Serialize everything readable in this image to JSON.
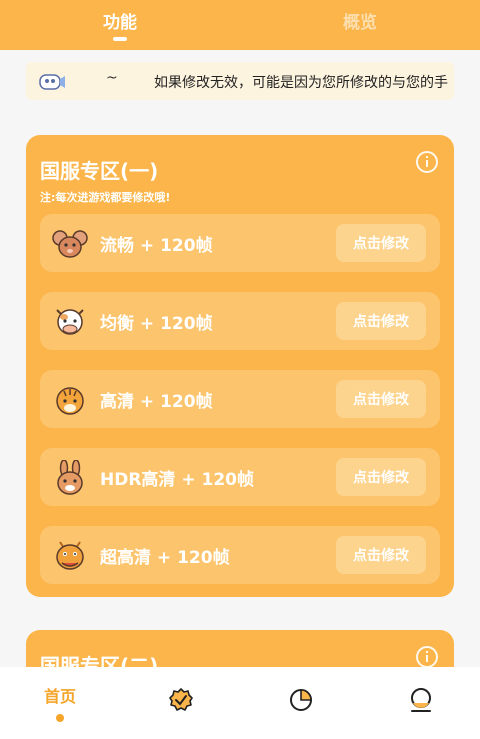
{
  "top_tabs": [
    {
      "label": "功能",
      "active": true
    },
    {
      "label": "概览",
      "active": false
    }
  ],
  "notice": {
    "prefix": "~",
    "text": "如果修改无效，可能是因为您所修改的与您的手"
  },
  "section1": {
    "title": "国服专区(一)",
    "note": "注:每次进游戏都要修改哦!",
    "rows": [
      {
        "label": "流畅 + 120帧",
        "button": "点击修改",
        "icon": "mouse-icon"
      },
      {
        "label": "均衡 + 120帧",
        "button": "点击修改",
        "icon": "cow-icon"
      },
      {
        "label": "高清 + 120帧",
        "button": "点击修改",
        "icon": "tiger-icon"
      },
      {
        "label": "HDR高清 + 120帧",
        "button": "点击修改",
        "icon": "rabbit-icon"
      },
      {
        "label": "超高清 + 120帧",
        "button": "点击修改",
        "icon": "dragon-icon"
      }
    ]
  },
  "section2": {
    "title": "国服专区(二)"
  },
  "bottom_nav": [
    {
      "label": "首页",
      "active": true,
      "icon": "home-icon"
    },
    {
      "label": "",
      "active": false,
      "icon": "badge-check-icon"
    },
    {
      "label": "",
      "active": false,
      "icon": "pie-chart-icon"
    },
    {
      "label": "",
      "active": false,
      "icon": "profile-icon"
    }
  ],
  "colors": {
    "accent": "#fbb54a",
    "row": "#fcc46c",
    "button": "#fdd48e",
    "nav_active": "#f4a52a",
    "notice_bg": "#fdf4df"
  }
}
